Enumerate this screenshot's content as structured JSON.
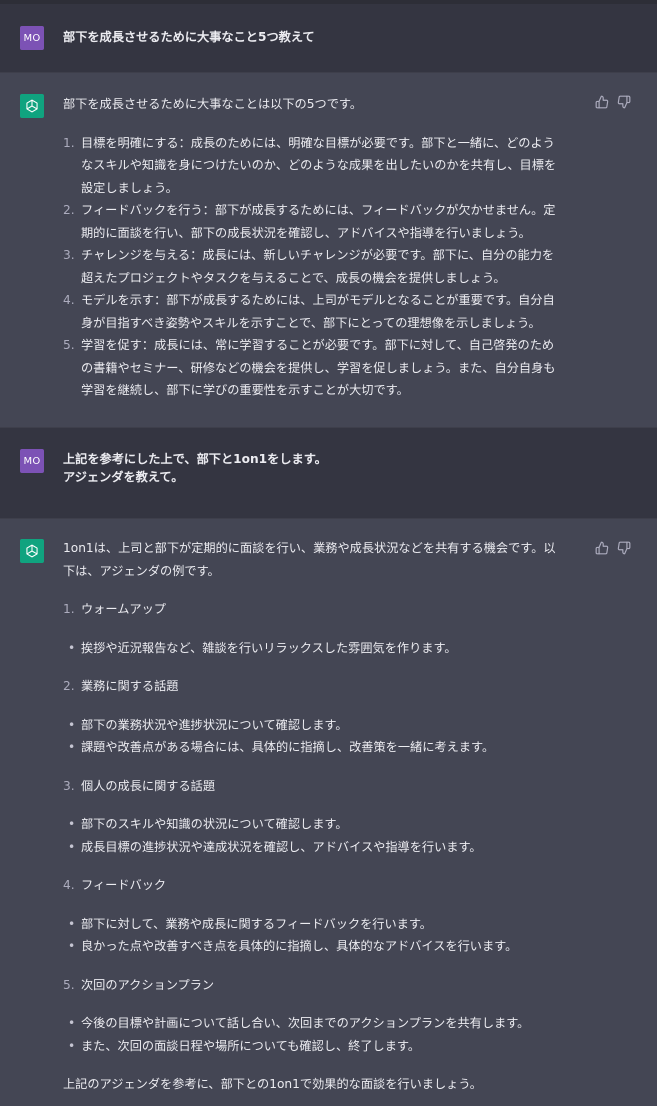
{
  "conversation": {
    "user1": {
      "avatar_initials": "MO",
      "text": "部下を成長させるために大事なこと5つ教えて"
    },
    "assistant1": {
      "intro": "部下を成長させるために大事なことは以下の5つです。",
      "items": [
        {
          "num": "1.",
          "lines": [
            "目標を明確にする：成長のためには、明確な目標が必要です。部下と一緒に、どのよう",
            "なスキルや知識を身につけたいのか、どのような成果を出したいのかを共有し、目標を",
            "設定しましょう。"
          ]
        },
        {
          "num": "2.",
          "lines": [
            "フィードバックを行う：部下が成長するためには、フィードバックが欠かせません。定",
            "期的に面談を行い、部下の成長状況を確認し、アドバイスや指導を行いましょう。"
          ]
        },
        {
          "num": "3.",
          "lines": [
            "チャレンジを与える：成長には、新しいチャレンジが必要です。部下に、自分の能力を",
            "超えたプロジェクトやタスクを与えることで、成長の機会を提供しましょう。"
          ]
        },
        {
          "num": "4.",
          "lines": [
            "モデルを示す：部下が成長するためには、上司がモデルとなることが重要です。自分自",
            "身が目指すべき姿勢やスキルを示すことで、部下にとっての理想像を示しましょう。"
          ]
        },
        {
          "num": "5.",
          "lines": [
            "学習を促す：成長には、常に学習することが必要です。部下に対して、自己啓発のため",
            "の書籍やセミナー、研修などの機会を提供し、学習を促しましょう。また、自分自身も",
            "学習を継続し、部下に学びの重要性を示すことが大切です。"
          ]
        }
      ]
    },
    "user2": {
      "avatar_initials": "MO",
      "lines": [
        "上記を参考にした上で、部下と1on1をします。",
        "アジェンダを教えて。"
      ]
    },
    "assistant2": {
      "intro_lines": [
        "1on1は、上司と部下が定期的に面談を行い、業務や成長状況などを共有する機会です。以",
        "下は、アジェンダの例です。"
      ],
      "sections": [
        {
          "num": "1.",
          "title": "ウォームアップ",
          "bullets": [
            "挨拶や近況報告など、雑談を行いリラックスした雰囲気を作ります。"
          ]
        },
        {
          "num": "2.",
          "title": "業務に関する話題",
          "bullets": [
            "部下の業務状況や進捗状況について確認します。",
            "課題や改善点がある場合には、具体的に指摘し、改善策を一緒に考えます。"
          ]
        },
        {
          "num": "3.",
          "title": "個人の成長に関する話題",
          "bullets": [
            "部下のスキルや知識の状況について確認します。",
            "成長目標の進捗状況や達成状況を確認し、アドバイスや指導を行います。"
          ]
        },
        {
          "num": "4.",
          "title": "フィードバック",
          "bullets": [
            "部下に対して、業務や成長に関するフィードバックを行います。",
            "良かった点や改善すべき点を具体的に指摘し、具体的なアドバイスを行います。"
          ]
        },
        {
          "num": "5.",
          "title": "次回のアクションプラン",
          "bullets": [
            "今後の目標や計画について話し合い、次回までのアクションプランを共有します。",
            "また、次回の面談日程や場所についても確認し、終了します。"
          ]
        }
      ],
      "closing": "上記のアジェンダを参考に、部下との1on1で効果的な面談を行いましょう。"
    }
  },
  "icons": {
    "thumbs_up": "thumbs-up-icon",
    "thumbs_down": "thumbs-down-icon",
    "assistant_logo": "openai-logo-icon"
  },
  "colors": {
    "user_bg": "#343541",
    "assistant_bg": "#444654",
    "user_avatar": "#7c52b5",
    "assistant_avatar": "#10a37f"
  }
}
